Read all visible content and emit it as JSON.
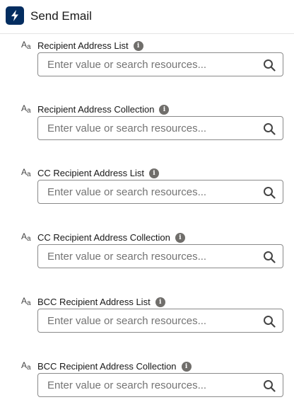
{
  "header": {
    "title": "Send Email",
    "icon": "lightning-bolt-icon",
    "icon_bg": "#032d60"
  },
  "type_icon_glyph": {
    "big": "A",
    "small": "a"
  },
  "fields": [
    {
      "label": "Recipient Address List",
      "placeholder": "Enter value or search resources...",
      "value": ""
    },
    {
      "label": "Recipient Address Collection",
      "placeholder": "Enter value or search resources...",
      "value": ""
    },
    {
      "label": "CC Recipient Address List",
      "placeholder": "Enter value or search resources...",
      "value": ""
    },
    {
      "label": "CC Recipient Address Collection",
      "placeholder": "Enter value or search resources...",
      "value": ""
    },
    {
      "label": "BCC Recipient Address List",
      "placeholder": "Enter value or search resources...",
      "value": ""
    },
    {
      "label": "BCC Recipient Address Collection",
      "placeholder": "Enter value or search resources...",
      "value": ""
    }
  ],
  "info_glyph": "i"
}
